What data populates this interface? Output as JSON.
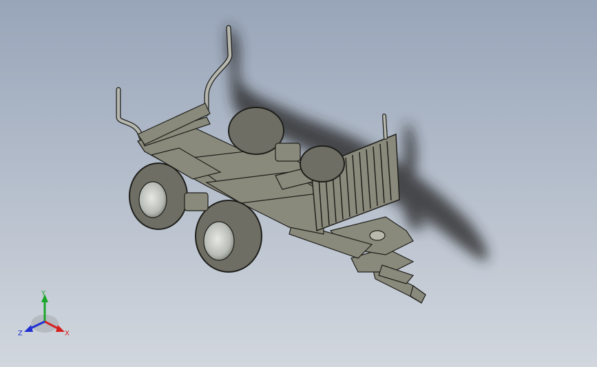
{
  "window": {
    "background_top": "#98a5b9",
    "background_bottom": "#d2d7de"
  },
  "model": {
    "body_color": "#8a8a7c",
    "edge_color": "#1e1e1a",
    "tire_color": "#6e6e64",
    "rim_color": "#c9ccc8",
    "shadow_color": "#2a2a2a"
  },
  "triad": {
    "x_label": "X",
    "y_label": "Y",
    "z_label": "Z",
    "x_color": "#d62020",
    "y_color": "#1aa62a",
    "z_color": "#2030d0"
  }
}
